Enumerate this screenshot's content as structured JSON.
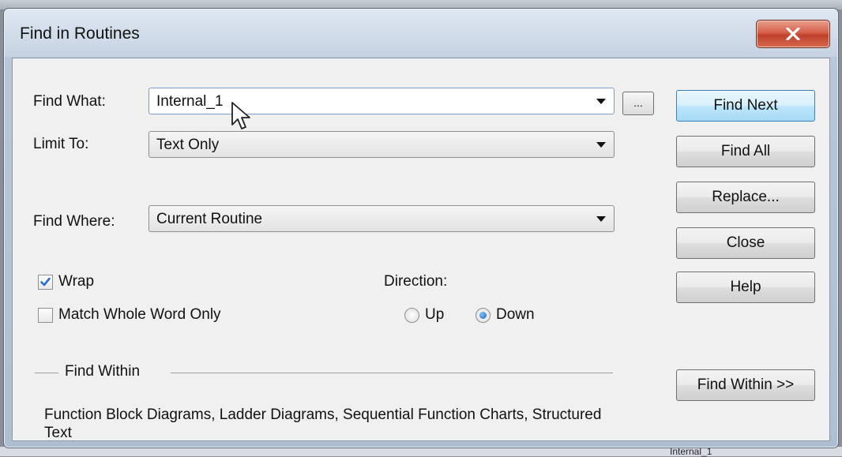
{
  "window": {
    "title": "Find in Routines",
    "close_glyph": "X"
  },
  "find_what": {
    "label": "Find What:",
    "value": "Internal_1",
    "browse_label": "..."
  },
  "limit_to": {
    "label": "Limit To:",
    "value": "Text Only"
  },
  "find_where": {
    "label": "Find Where:",
    "value": "Current Routine"
  },
  "options": {
    "wrap": {
      "label": "Wrap",
      "checked": true
    },
    "match_whole_word": {
      "label": "Match Whole Word Only",
      "checked": false
    }
  },
  "direction": {
    "label": "Direction:",
    "up_label": "Up",
    "down_label": "Down",
    "selected": "Down"
  },
  "buttons": {
    "find_next": "Find Next",
    "find_all": "Find All",
    "replace": "Replace...",
    "close": "Close",
    "help": "Help",
    "find_within": "Find Within >>"
  },
  "find_within": {
    "group_label": "Find Within",
    "description": "Function Block Diagrams, Ladder Diagrams, Sequential Function Charts, Structured Text"
  },
  "background": {
    "cell_text": "Internal_1"
  },
  "colors": {
    "close_red": "#c0402b",
    "default_button_blue": "#bee6fd",
    "check_blue": "#2a6fc9"
  }
}
